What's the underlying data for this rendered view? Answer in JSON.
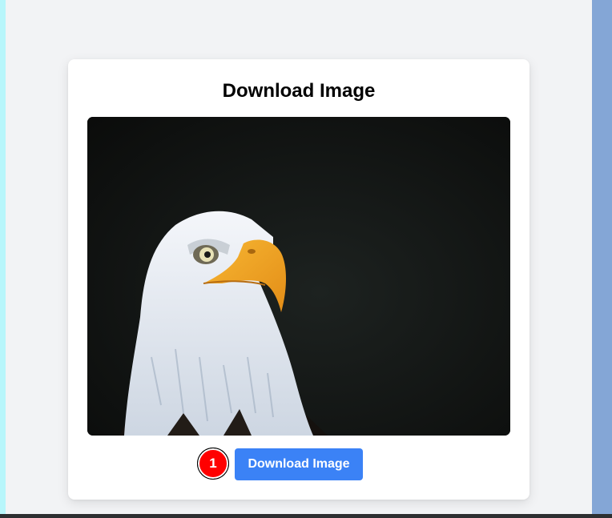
{
  "card": {
    "title": "Download Image"
  },
  "image": {
    "subject": "bald-eagle-photo"
  },
  "actions": {
    "badge_number": "1",
    "download_label": "Download Image"
  },
  "colors": {
    "accent": "#3b82f6",
    "badge": "#ff0000",
    "page_bg": "#f2f3f5",
    "left_strip": "#b8f6fb",
    "right_strip": "#84a6d6"
  }
}
